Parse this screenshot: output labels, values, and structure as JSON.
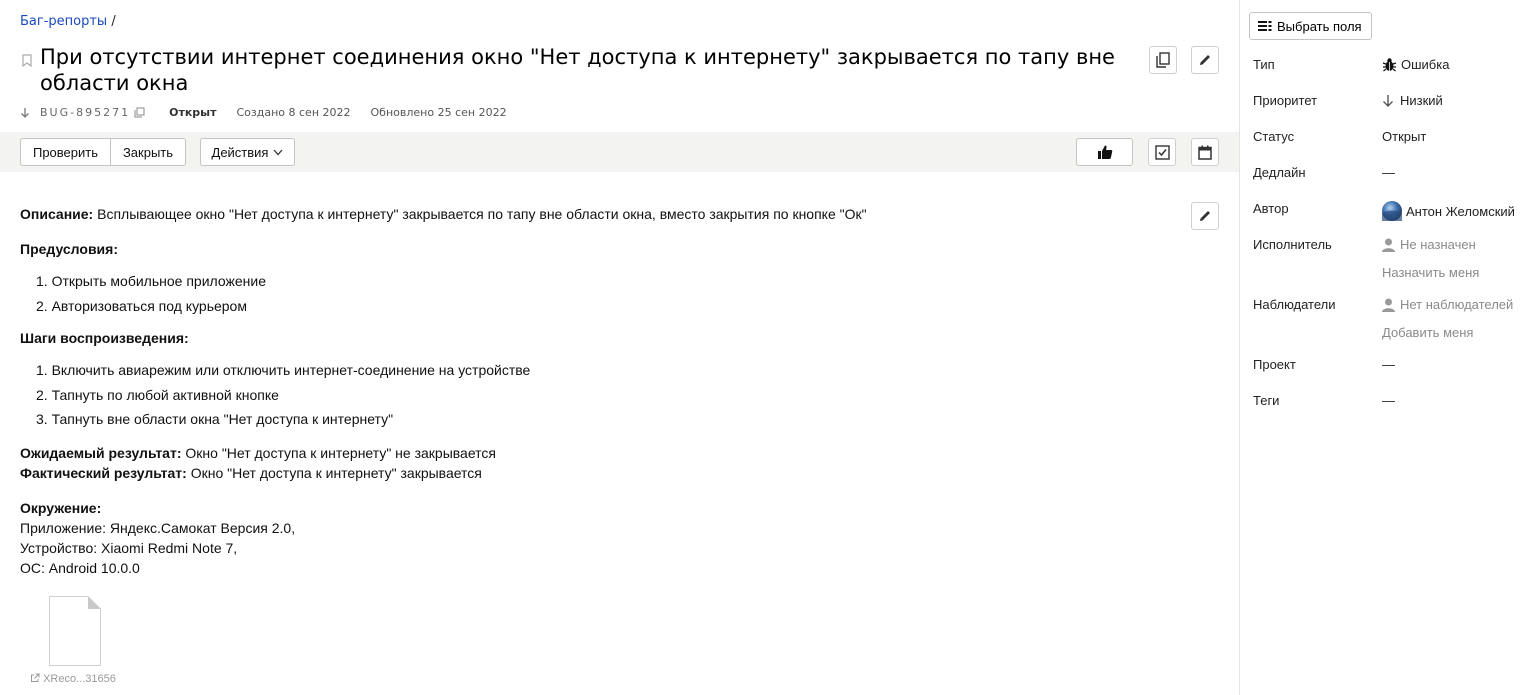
{
  "breadcrumb": {
    "link": "Баг-репорты",
    "separator": "/"
  },
  "issue": {
    "title": "При отсутствии интернет соединения окно \"Нет доступа к интернету\" закрывается по тапу вне области окна",
    "key": "BUG-895271",
    "status": "Открыт",
    "created": "Создано 8 сен 2022",
    "updated": "Обновлено 25 сен 2022"
  },
  "toolbar": {
    "check_label": "Проверить",
    "close_label": "Закрыть",
    "actions_label": "Действия"
  },
  "description": {
    "desc_label": "Описание:",
    "desc_text": "Всплывающее окно \"Нет доступа к интернету\" закрывается по тапу вне области окна, вместо закрытия по кнопке \"Ок\"",
    "preconditions_label": "Предусловия:",
    "preconditions": [
      "1. Открыть мобильное приложение",
      "2. Авторизоваться под курьером"
    ],
    "steps_label": "Шаги воспроизведения:",
    "steps": [
      "1. Включить авиарежим или отключить интернет-соединение на устройстве",
      "2. Тапнуть по любой активной кнопке",
      "3. Тапнуть вне области окна \"Нет доступа к интернету\""
    ],
    "expected_label": "Ожидаемый результат:",
    "expected_text": "Окно \"Нет доступа к интернету\" не закрывается",
    "actual_label": "Фактический результат:",
    "actual_text": "Окно \"Нет доступа к интернету\" закрывается",
    "env_label": "Окружение:",
    "env_lines": [
      "Приложение: Яндекс.Самокат Версия 2.0,",
      "Устройство: Xiaomi Redmi Note 7,",
      "ОС: Android 10.0.0"
    ],
    "attachment_name": "XReco...31656"
  },
  "sidebar": {
    "choose_fields": "Выбрать поля",
    "type_label": "Тип",
    "type_value": "Ошибка",
    "priority_label": "Приоритет",
    "priority_value": "Низкий",
    "status_label": "Статус",
    "status_value": "Открыт",
    "deadline_label": "Дедлайн",
    "deadline_value": "—",
    "author_label": "Автор",
    "author_value": "Антон Желомский",
    "assignee_label": "Исполнитель",
    "assignee_value": "Не назначен",
    "assign_me": "Назначить меня",
    "watchers_label": "Наблюдатели",
    "watchers_value": "Нет наблюдателей",
    "add_me": "Добавить меня",
    "project_label": "Проект",
    "project_value": "—",
    "tags_label": "Теги",
    "tags_value": "—"
  },
  "colors": {
    "link": "#1a49bd",
    "toolbar_bg": "#f3f3f1",
    "muted": "#8a8a8a"
  }
}
